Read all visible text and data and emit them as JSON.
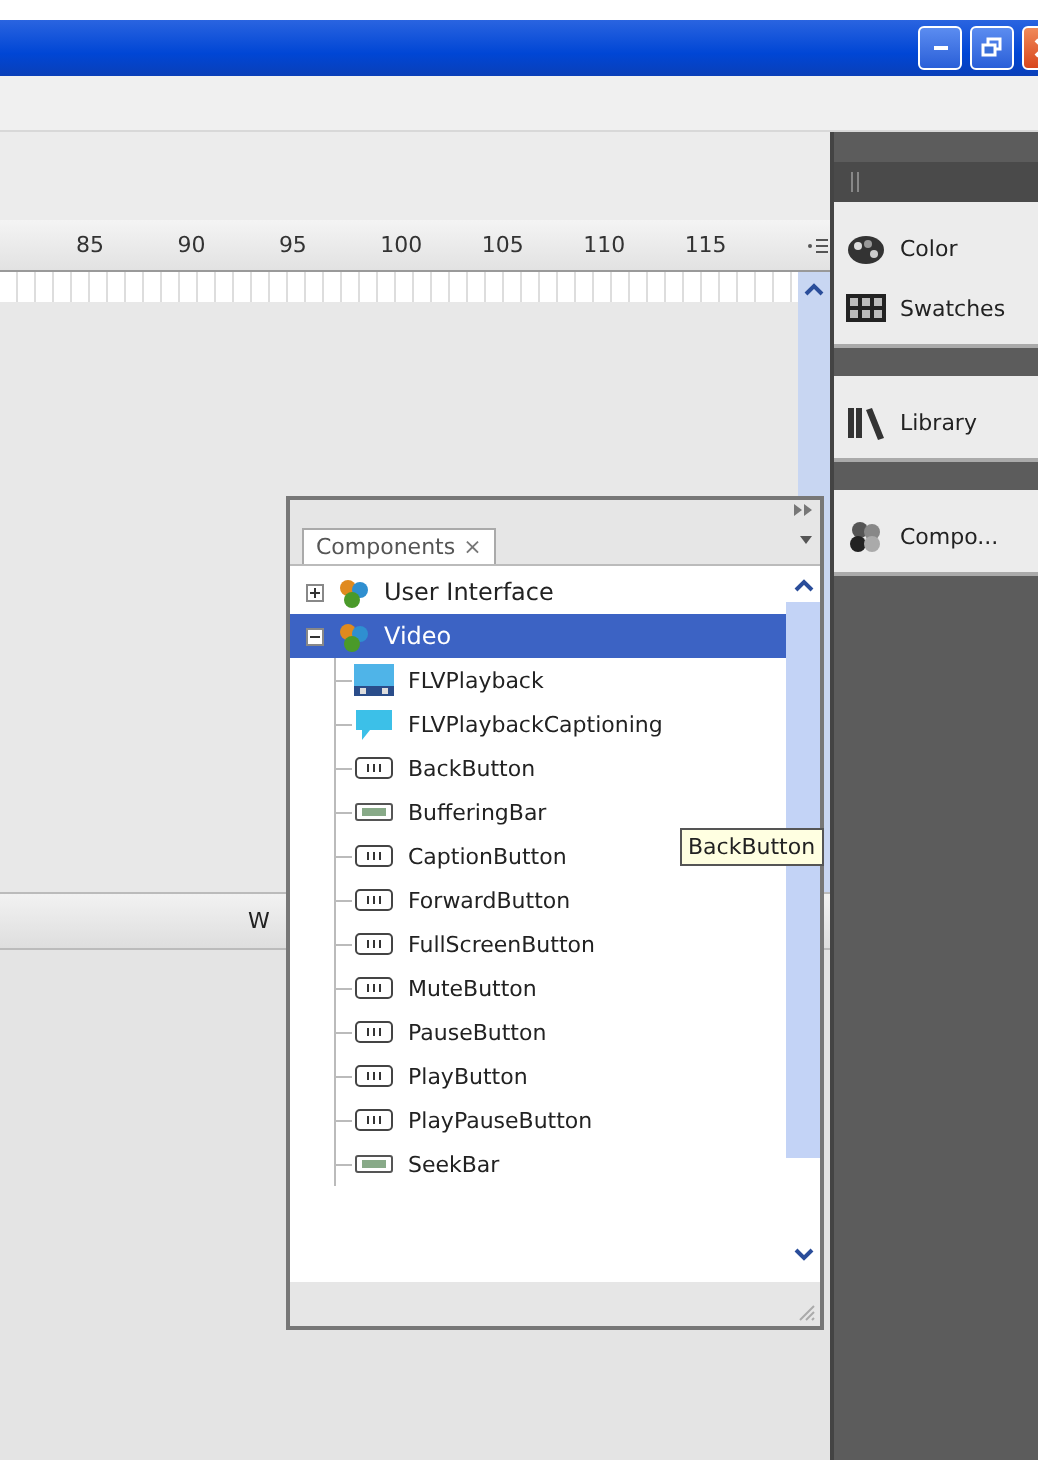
{
  "ruler": {
    "labels": [
      "85",
      "90",
      "95",
      "100",
      "105",
      "110",
      "115"
    ]
  },
  "dock": {
    "groups": [
      [
        {
          "label": "Color",
          "kind": "color"
        },
        {
          "label": "Swatches",
          "kind": "swatches"
        }
      ],
      [
        {
          "label": "Library",
          "kind": "library"
        }
      ],
      [
        {
          "label": "Compo...",
          "kind": "components"
        }
      ]
    ]
  },
  "components_panel": {
    "tab": {
      "label": "Components",
      "close": "×"
    },
    "tree": [
      {
        "label": "User Interface",
        "expanded": false,
        "selected": false
      },
      {
        "label": "Video",
        "expanded": true,
        "selected": true,
        "children": [
          {
            "label": "FLVPlayback",
            "kind": "playback"
          },
          {
            "label": "FLVPlaybackCaptioning",
            "kind": "caption"
          },
          {
            "label": "BackButton",
            "kind": "button"
          },
          {
            "label": "BufferingBar",
            "kind": "bar"
          },
          {
            "label": "CaptionButton",
            "kind": "button"
          },
          {
            "label": "ForwardButton",
            "kind": "button"
          },
          {
            "label": "FullScreenButton",
            "kind": "button"
          },
          {
            "label": "MuteButton",
            "kind": "button"
          },
          {
            "label": "PauseButton",
            "kind": "button"
          },
          {
            "label": "PlayButton",
            "kind": "button"
          },
          {
            "label": "PlayPauseButton",
            "kind": "button"
          },
          {
            "label": "SeekBar",
            "kind": "bar"
          }
        ]
      }
    ]
  },
  "tooltip": "BackButton",
  "stage_bar": {
    "label": "W"
  }
}
